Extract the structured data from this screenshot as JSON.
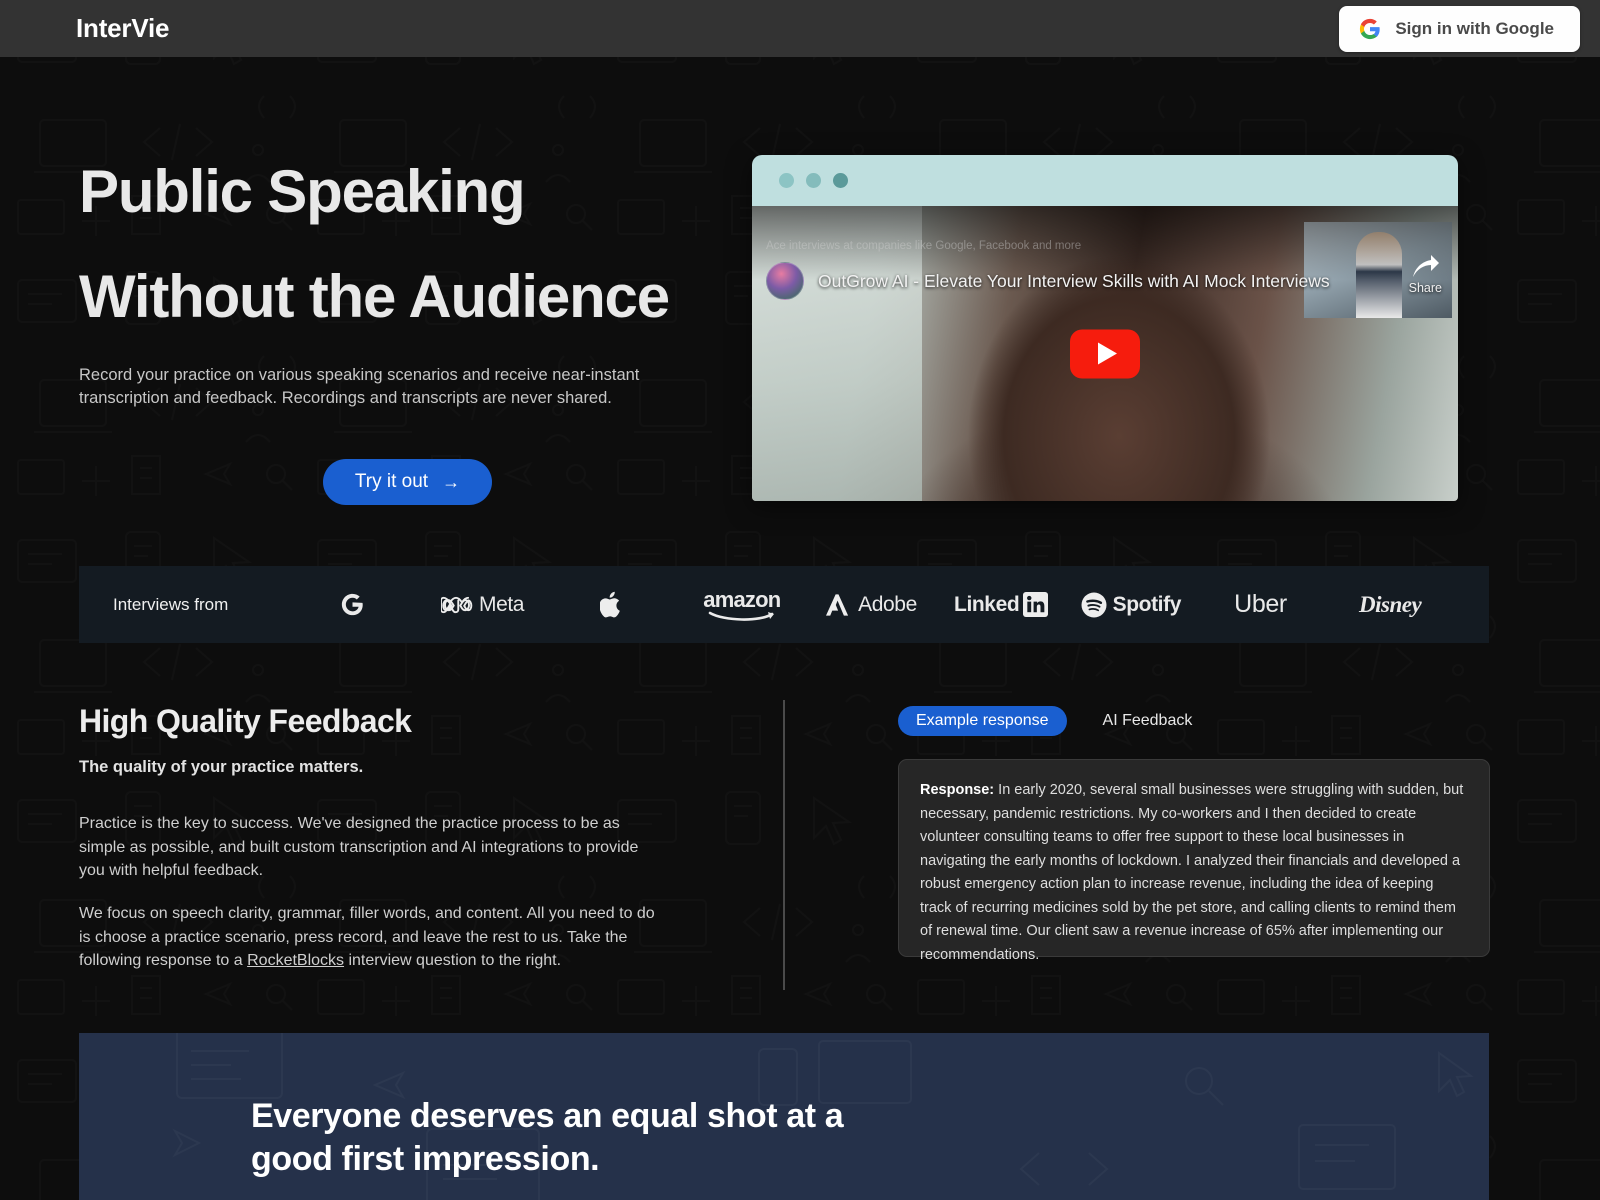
{
  "topbar": {
    "logo": "InterVie",
    "google_signin_label": "Sign in with Google",
    "google_icon": "google-g-icon"
  },
  "hero": {
    "headline_line1": "Public Speaking",
    "headline_line2": "Without the Audience",
    "subtext": "Record your practice on various speaking scenarios and receive near-instant transcription and feedback. Recordings and transcripts are never shared.",
    "cta_label": "Try it out",
    "cta_arrow": "→"
  },
  "video": {
    "pretitle": "Ace interviews at companies like Google, Facebook and more",
    "title": "OutGrow AI - Elevate Your Interview Skills with AI Mock Interviews",
    "share_label": "Share",
    "play_icon": "youtube-play-icon",
    "window_dots": [
      "dot-1",
      "dot-2",
      "dot-3"
    ]
  },
  "logo_strip": {
    "label": "Interviews from",
    "brands": [
      {
        "name": "Google",
        "icon": "google-g-icon",
        "text": ""
      },
      {
        "name": "Meta",
        "icon": "meta-infinity-icon",
        "text": "Meta"
      },
      {
        "name": "Apple",
        "icon": "apple-icon",
        "text": ""
      },
      {
        "name": "Amazon",
        "icon": "amazon-smile-icon",
        "text": "amazon"
      },
      {
        "name": "Adobe",
        "icon": "adobe-a-icon",
        "text": "Adobe"
      },
      {
        "name": "LinkedIn",
        "icon": "linkedin-in-icon",
        "text": "Linked"
      },
      {
        "name": "Spotify",
        "icon": "spotify-icon",
        "text": "Spotify"
      },
      {
        "name": "Uber",
        "icon": "uber-icon",
        "text": "Uber"
      },
      {
        "name": "Disney",
        "icon": "disney-icon",
        "text": "Disney"
      }
    ]
  },
  "feedback": {
    "title": "High Quality Feedback",
    "subtitle": "The quality of your practice matters.",
    "paragraph1": "Practice is the key to success. We've designed the practice process to be as simple as possible, and built custom transcription and AI integrations to provide you with helpful feedback.",
    "paragraph2_before": "We focus on speech clarity, grammar, filler words, and content. All you need to do is choose a practice scenario, press record, and leave the rest to us. Take the following response to a ",
    "paragraph2_link": "RocketBlocks",
    "paragraph2_after": " interview question to the right.",
    "tabs": [
      {
        "label": "Example response",
        "active": true
      },
      {
        "label": "AI Feedback",
        "active": false
      }
    ],
    "response_label": "Response:",
    "response_body": " In early 2020, several small businesses were struggling with sudden, but necessary, pandemic restrictions. My co-workers and I then decided to create volunteer consulting teams to offer free support to these local businesses in navigating the early months of lockdown. I analyzed their financials and developed a robust emergency action plan to increase revenue, including the idea of keeping track of recurring medicines sold by the pet store, and calling clients to remind them of renewal time. Our client saw a revenue increase of 65% after implementing our recommendations."
  },
  "bottom_band": {
    "heading": "Everyone deserves an equal shot at a good first impression."
  },
  "colors": {
    "page_background": "#0d0d0d",
    "topbar_background": "#333333",
    "accent_blue": "#1a5fd0",
    "strip_background": "#141b22",
    "card_background": "#262626",
    "band_background": "#25314a",
    "titlebar_teal": "#bfdfdf",
    "play_red": "#f61c0d"
  }
}
